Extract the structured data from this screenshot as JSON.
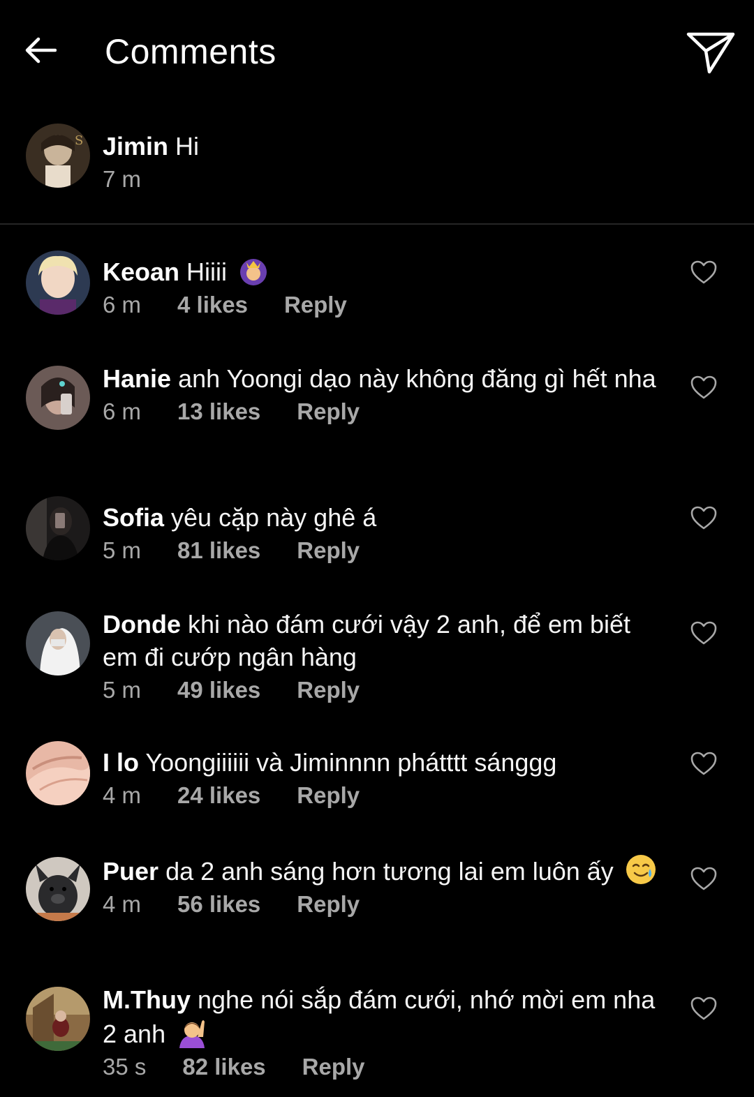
{
  "header": {
    "title": "Comments",
    "back_icon": "arrow-left-icon",
    "send_icon": "paper-plane-icon"
  },
  "caption": {
    "username": "Jimin",
    "text": "Hi",
    "time": "7 m"
  },
  "comments": [
    {
      "username": "Keoan",
      "text": "Hiiii",
      "emoji": "woman-with-crown-emoji",
      "time": "6 m",
      "likes": "4 likes",
      "reply": "Reply"
    },
    {
      "username": "Hanie",
      "text": "anh Yoongi dạo này không đăng gì hết nha",
      "time": "6 m",
      "likes": "13 likes",
      "reply": "Reply"
    },
    {
      "username": "Sofia",
      "text": "yêu cặp này ghê á",
      "time": "5 m",
      "likes": "81 likes",
      "reply": "Reply"
    },
    {
      "username": "Donde",
      "text": "khi nào đám cưới vậy 2 anh, để em biết em đi cướp ngân hàng",
      "time": "5 m",
      "likes": "49 likes",
      "reply": "Reply"
    },
    {
      "username": "I lo",
      "text": "Yoongiiiiii và Jiminnnn phátttt sánggg",
      "time": "4 m",
      "likes": "24 likes",
      "reply": "Reply"
    },
    {
      "username": "Puer",
      "text": "da 2 anh sáng hơn tương lai em luôn ấy",
      "emoji": "smiling-face-with-tear-emoji",
      "time": "4 m",
      "likes": "56 likes",
      "reply": "Reply"
    },
    {
      "username": "M.Thuy",
      "text": "nghe nói sắp đám cưới, nhớ mời em nha 2 anh",
      "emoji": "woman-raising-hand-emoji",
      "time": "35 s",
      "likes": "82 likes",
      "reply": "Reply"
    }
  ],
  "colors": {
    "background": "#000000",
    "text": "#f5f5f5",
    "meta": "#a8a8a8",
    "divider": "#262626"
  }
}
